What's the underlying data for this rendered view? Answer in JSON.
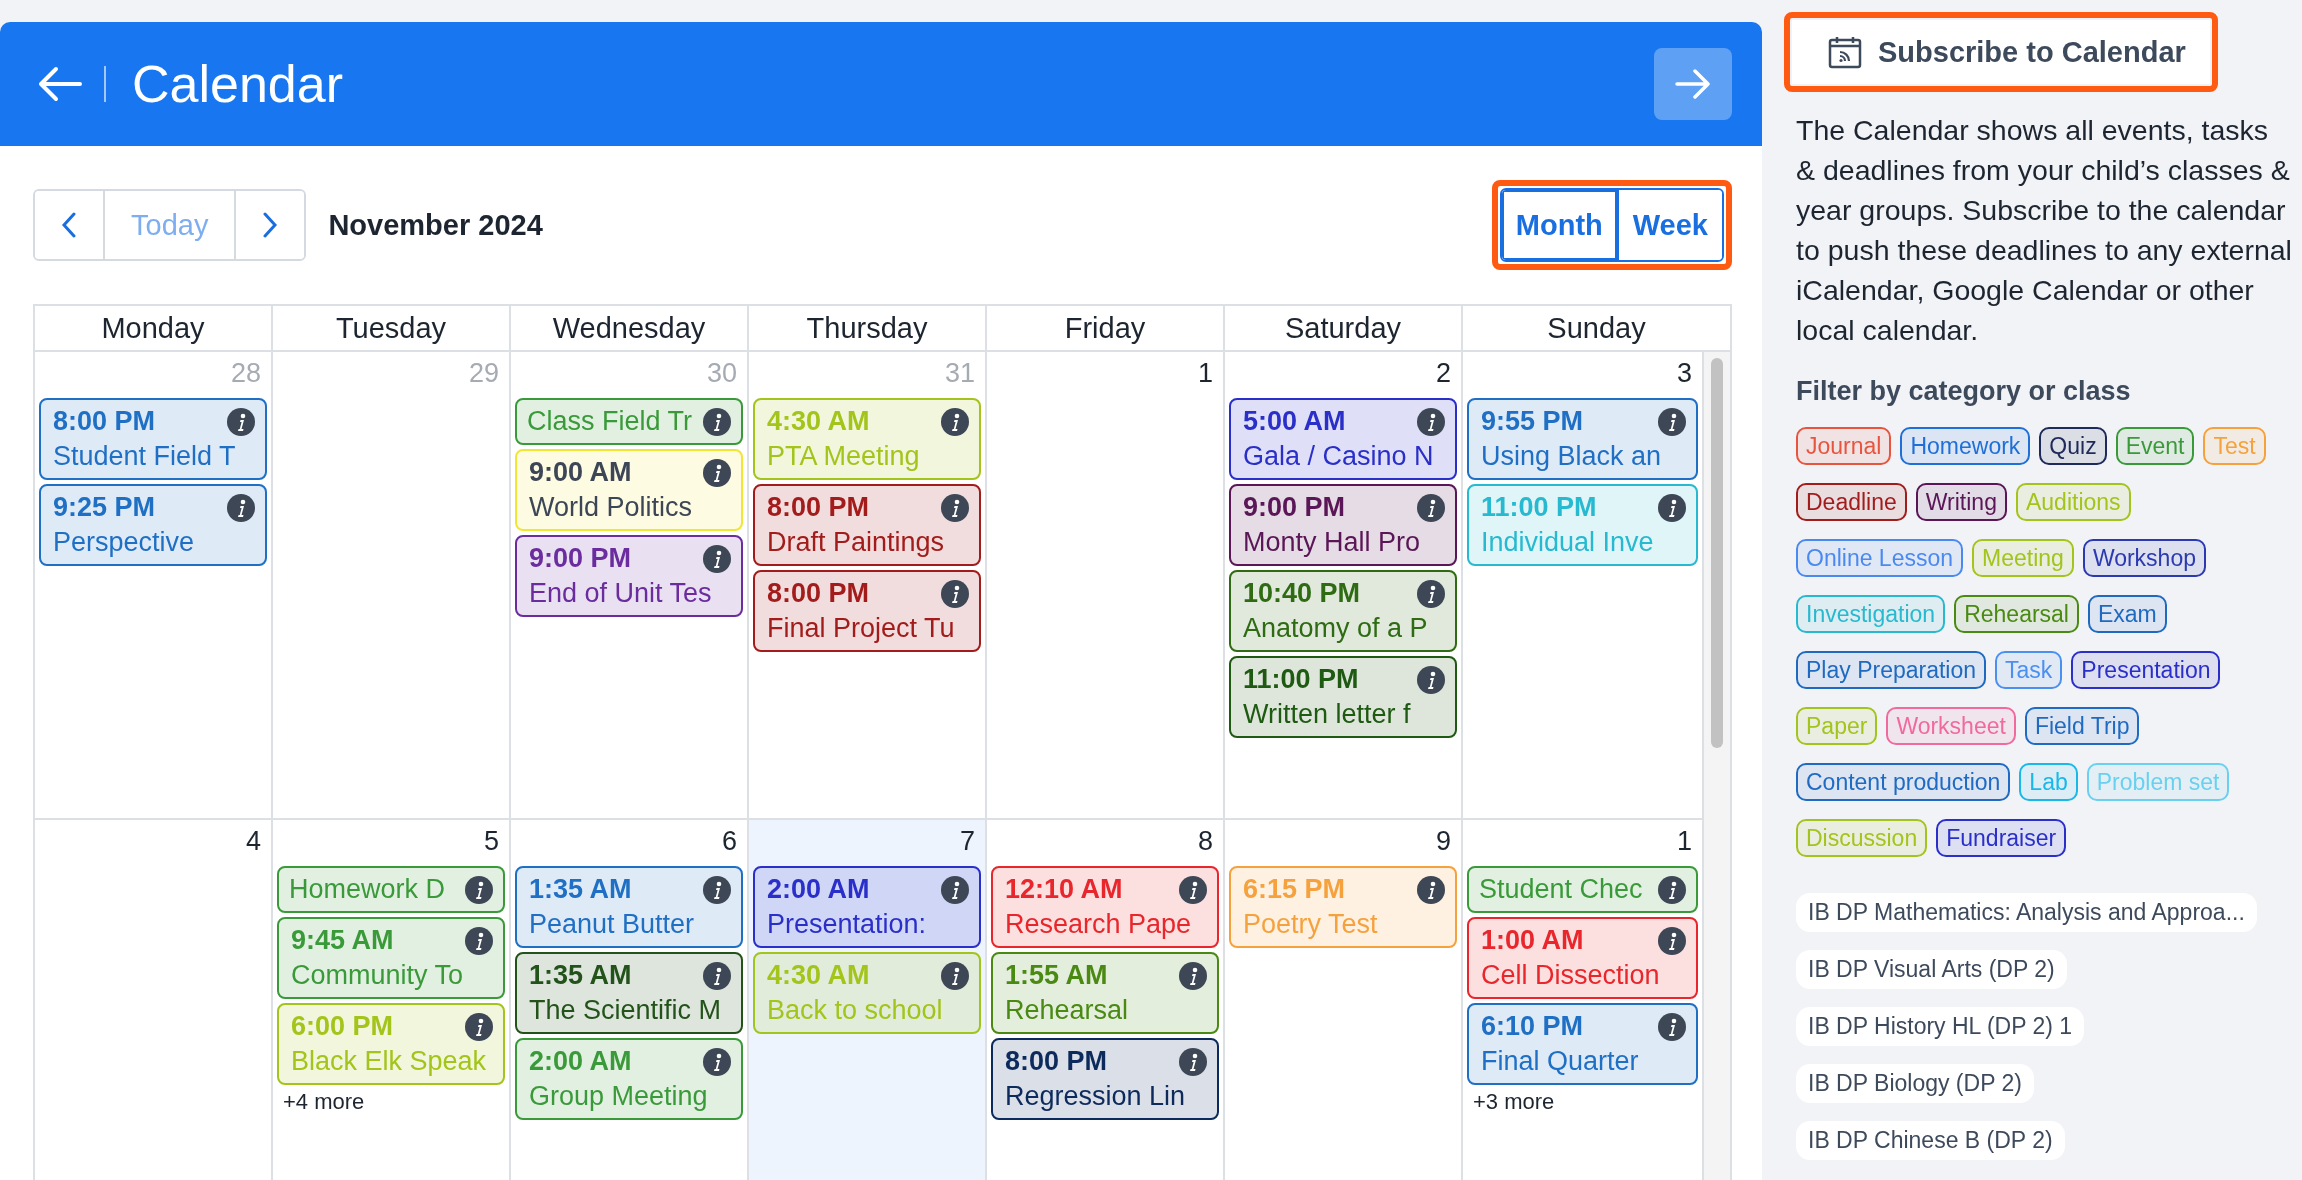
{
  "header": {
    "title": "Calendar"
  },
  "toolbar": {
    "today": {
      "label": "Today",
      "disabled": true
    },
    "period": "November 2024",
    "views": [
      {
        "label": "Month",
        "selected": true
      },
      {
        "label": "Week",
        "selected": false
      }
    ]
  },
  "weekdays": [
    "Monday",
    "Tuesday",
    "Wednesday",
    "Thursday",
    "Friday",
    "Saturday",
    "Sunday"
  ],
  "weeks": [
    {
      "days": [
        {
          "number": "28",
          "outside": true,
          "today": false,
          "events": [
            {
              "kind": "timed",
              "time": "8:00 PM",
              "title": "Student Field T",
              "color": "#1f6fc5"
            },
            {
              "kind": "timed",
              "time": "9:25 PM",
              "title": "Perspective",
              "color": "#1f6fc5"
            }
          ]
        },
        {
          "number": "29",
          "outside": true,
          "today": false
        },
        {
          "number": "30",
          "outside": true,
          "today": false,
          "events": [
            {
              "kind": "allday",
              "title": "Class Field Tr",
              "color": "#3a9a3a"
            },
            {
              "kind": "timed",
              "time": "9:00 AM",
              "title": "World Politics",
              "color": "#f2e635",
              "dark_text": true
            },
            {
              "kind": "timed",
              "time": "9:00 PM",
              "title": "End of Unit Tes",
              "color": "#6b2d9e"
            }
          ]
        },
        {
          "number": "31",
          "outside": true,
          "today": false,
          "events": [
            {
              "kind": "timed",
              "time": "4:30 AM",
              "title": "PTA Meeting",
              "color": "#a3c41a"
            },
            {
              "kind": "timed",
              "time": "8:00 PM",
              "title": "Draft Paintings",
              "color": "#a31c1c"
            },
            {
              "kind": "timed",
              "time": "8:00 PM",
              "title": "Final Project Tu",
              "color": "#a31c1c"
            }
          ]
        },
        {
          "number": "1",
          "outside": false,
          "today": false
        },
        {
          "number": "2",
          "outside": false,
          "today": false,
          "events": [
            {
              "kind": "timed",
              "time": "5:00 AM",
              "title": "Gala / Casino N",
              "color": "#2b2fc9"
            },
            {
              "kind": "timed",
              "time": "9:00 PM",
              "title": "Monty Hall Pro",
              "color": "#5a1656"
            },
            {
              "kind": "timed",
              "time": "10:40 PM",
              "title": "Anatomy of a P",
              "color": "#2e6b12"
            },
            {
              "kind": "timed",
              "time": "11:00 PM",
              "title": "Written letter f",
              "color": "#1f5a12"
            }
          ]
        },
        {
          "number": "3",
          "outside": false,
          "today": false,
          "events": [
            {
              "kind": "timed",
              "time": "9:55 PM",
              "title": "Using Black an",
              "color": "#1f6fc5"
            },
            {
              "kind": "timed",
              "time": "11:00 PM",
              "title": "Individual Inve",
              "color": "#27b9cf"
            }
          ]
        }
      ]
    },
    {
      "days": [
        {
          "number": "4",
          "outside": false,
          "today": false
        },
        {
          "number": "5",
          "outside": false,
          "today": false,
          "events": [
            {
              "kind": "allday",
              "title": "Homework D",
              "color": "#3a9a3a"
            },
            {
              "kind": "timed",
              "time": "9:45 AM",
              "title": "Community To",
              "color": "#3a9a3a"
            },
            {
              "kind": "timed",
              "time": "6:00 PM",
              "title": "Black Elk Speak",
              "color": "#a3c41a"
            }
          ],
          "more": "+4 more"
        },
        {
          "number": "6",
          "outside": false,
          "today": false,
          "events": [
            {
              "kind": "timed",
              "time": "1:35 AM",
              "title": "Peanut Butter",
              "color": "#1f6fc5"
            },
            {
              "kind": "timed",
              "time": "1:35 AM",
              "title": "The Scientific M",
              "color": "#23531a"
            },
            {
              "kind": "timed",
              "time": "2:00 AM",
              "title": "Group Meeting",
              "color": "#3a9a3a"
            }
          ]
        },
        {
          "number": "7",
          "outside": false,
          "today": true,
          "events": [
            {
              "kind": "timed",
              "time": "2:00 AM",
              "title": "Presentation:",
              "color": "#2b2fc9"
            },
            {
              "kind": "timed",
              "time": "4:30 AM",
              "title": "Back to school",
              "color": "#a3c41a"
            }
          ]
        },
        {
          "number": "8",
          "outside": false,
          "today": false,
          "events": [
            {
              "kind": "timed",
              "time": "12:10 AM",
              "title": "Research Pape",
              "color": "#e8262b"
            },
            {
              "kind": "timed",
              "time": "1:55 AM",
              "title": "Rehearsal",
              "color": "#4a8a12"
            },
            {
              "kind": "timed",
              "time": "8:00 PM",
              "title": "Regression Lin",
              "color": "#0c2a5c"
            }
          ]
        },
        {
          "number": "9",
          "outside": false,
          "today": false,
          "events": [
            {
              "kind": "timed",
              "time": "6:15 PM",
              "title": "Poetry Test",
              "color": "#f5a23e"
            }
          ]
        },
        {
          "number": "1",
          "outside": false,
          "today": false,
          "events": [
            {
              "kind": "allday",
              "title": "Student Chec",
              "color": "#3a9a3a"
            },
            {
              "kind": "timed",
              "time": "1:00 AM",
              "title": "Cell Dissection",
              "color": "#e8262b"
            },
            {
              "kind": "timed",
              "time": "6:10 PM",
              "title": "Final Quarter",
              "color": "#1f6fc5"
            }
          ],
          "more": "+3 more"
        }
      ]
    }
  ],
  "sidebar": {
    "subscribe": "Subscribe to Calendar",
    "description": "The Calendar shows all events, tasks & deadlines from your child’s classes & year groups. Subscribe to the calendar to push these deadlines to any external iCalendar, Google Calendar or other local calendar.",
    "filter_heading": "Filter by category or class",
    "categories": [
      {
        "label": "Journal",
        "color": "#e8553e"
      },
      {
        "label": "Homework",
        "color": "#1f6fd9"
      },
      {
        "label": "Quiz",
        "color": "#1e2a5a"
      },
      {
        "label": "Event",
        "color": "#3a9a3a"
      },
      {
        "label": "Test",
        "color": "#f5a23e"
      },
      {
        "label": "Deadline",
        "color": "#a31c1c"
      },
      {
        "label": "Writing",
        "color": "#5a1656"
      },
      {
        "label": "Auditions",
        "color": "#a3c41a"
      },
      {
        "label": "Online Lesson",
        "color": "#4a8af0"
      },
      {
        "label": "Meeting",
        "color": "#a3c41b"
      },
      {
        "label": "Workshop",
        "color": "#2b3ab0"
      },
      {
        "label": "Investigation",
        "color": "#27b9cf"
      },
      {
        "label": "Rehearsal",
        "color": "#4a8a12"
      },
      {
        "label": "Exam",
        "color": "#1f6ac0"
      },
      {
        "label": "Play Preparation",
        "color": "#1f6ac1"
      },
      {
        "label": "Task",
        "color": "#4a90f0"
      },
      {
        "label": "Presentation",
        "color": "#2b2fc9"
      },
      {
        "label": "Paper",
        "color": "#a3c41c"
      },
      {
        "label": "Worksheet",
        "color": "#f06aa0"
      },
      {
        "label": "Field Trip",
        "color": "#1f6ac2"
      },
      {
        "label": "Content production",
        "color": "#1f6ac3"
      },
      {
        "label": "Lab",
        "color": "#1ab8e8"
      },
      {
        "label": "Problem set",
        "color": "#6ad0f0"
      },
      {
        "label": "Discussion",
        "color": "#a3c41d"
      },
      {
        "label": "Fundraiser",
        "color": "#2b2fca"
      }
    ],
    "classes": [
      "IB DP Mathematics: Analysis and Approa...",
      "IB DP Visual Arts (DP 2)",
      "IB DP History HL (DP 2) 1",
      "IB DP Biology (DP 2)",
      "IB DP Chinese B (DP 2)"
    ]
  }
}
